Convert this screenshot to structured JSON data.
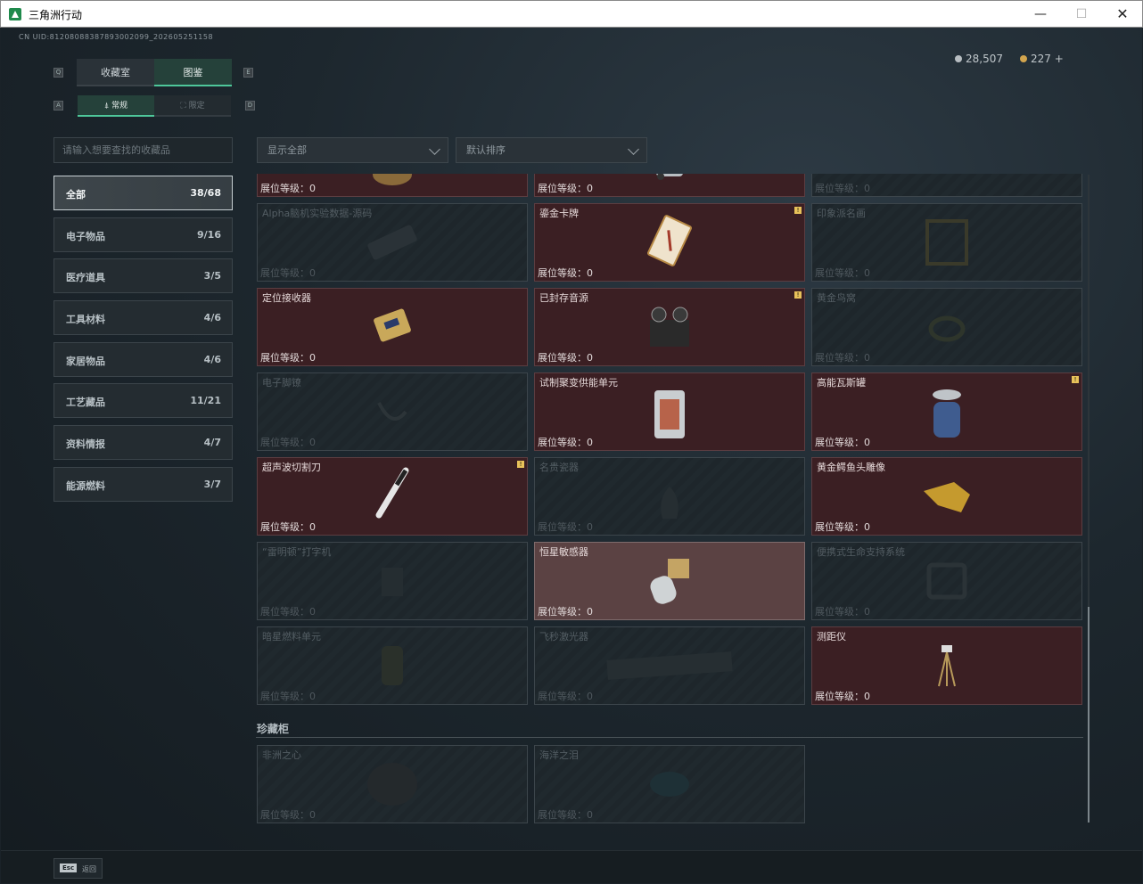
{
  "window": {
    "title": "三角洲行动",
    "min": "—",
    "max": "☐",
    "close": "✕"
  },
  "uid": "CN UID:81208088387893002099_202605251158",
  "currency": {
    "silver": "28,507",
    "gold": "227 +"
  },
  "tabs_main": [
    {
      "label": "收藏室"
    },
    {
      "label": "图鉴"
    }
  ],
  "tabs_sub": [
    {
      "label": "⍋ 常规"
    },
    {
      "label": "⛶ 限定"
    }
  ],
  "search": {
    "placeholder": "请输入想要查找的收藏品"
  },
  "filter": {
    "value": "显示全部"
  },
  "sort": {
    "value": "默认排序"
  },
  "categories": [
    {
      "label": "全部",
      "count": "38/68"
    },
    {
      "label": "电子物品",
      "count": "9/16"
    },
    {
      "label": "医疗道具",
      "count": "3/5"
    },
    {
      "label": "工具材料",
      "count": "4/6"
    },
    {
      "label": "家居物品",
      "count": "4/6"
    },
    {
      "label": "工艺藏品",
      "count": "11/21"
    },
    {
      "label": "资料情报",
      "count": "4/7"
    },
    {
      "label": "能源燃料",
      "count": "3/7"
    }
  ],
  "level_label": "展位等级：0",
  "items": [
    {
      "name": "",
      "level": "展位等级：0"
    },
    {
      "name": "",
      "level": "展位等级：0"
    },
    {
      "name": "",
      "level": "展位等级：0"
    },
    {
      "name": "Alpha脑机实验数据-源码",
      "level": "展位等级：0"
    },
    {
      "name": "鎏金卡牌",
      "level": "展位等级：0"
    },
    {
      "name": "印象派名画",
      "level": "展位等级：0"
    },
    {
      "name": "定位接收器",
      "level": "展位等级：0"
    },
    {
      "name": "已封存音源",
      "level": "展位等级：0"
    },
    {
      "name": "黄金鸟窝",
      "level": "展位等级：0"
    },
    {
      "name": "电子脚镣",
      "level": "展位等级：0"
    },
    {
      "name": "试制聚变供能单元",
      "level": "展位等级：0"
    },
    {
      "name": "高能瓦斯罐",
      "level": "展位等级：0"
    },
    {
      "name": "超声波切割刀",
      "level": "展位等级：0"
    },
    {
      "name": "名贵瓷器",
      "level": "展位等级：0"
    },
    {
      "name": "黄金鳄鱼头雕像",
      "level": "展位等级：0"
    },
    {
      "name": "“雷明顿”打字机",
      "level": "展位等级：0"
    },
    {
      "name": "恒星敏感器",
      "level": "展位等级：0"
    },
    {
      "name": "便携式生命支持系统",
      "level": "展位等级：0"
    },
    {
      "name": "暗星燃料单元",
      "level": "展位等级：0"
    },
    {
      "name": "飞秒激光器",
      "level": "展位等级：0"
    },
    {
      "name": "测距仪",
      "level": "展位等级：0"
    }
  ],
  "section": {
    "title": "珍藏柜"
  },
  "treasures": [
    {
      "name": "非洲之心",
      "level": "展位等级：0"
    },
    {
      "name": "海洋之泪",
      "level": "展位等级：0"
    }
  ],
  "badge": "!",
  "bottom": {
    "key": "Esc",
    "label": "返回"
  },
  "colors": {
    "accent": "#4ec79a",
    "owned_card": "#3b1f23",
    "selected_card": "#5b4243",
    "badge": "#e8c25a"
  }
}
